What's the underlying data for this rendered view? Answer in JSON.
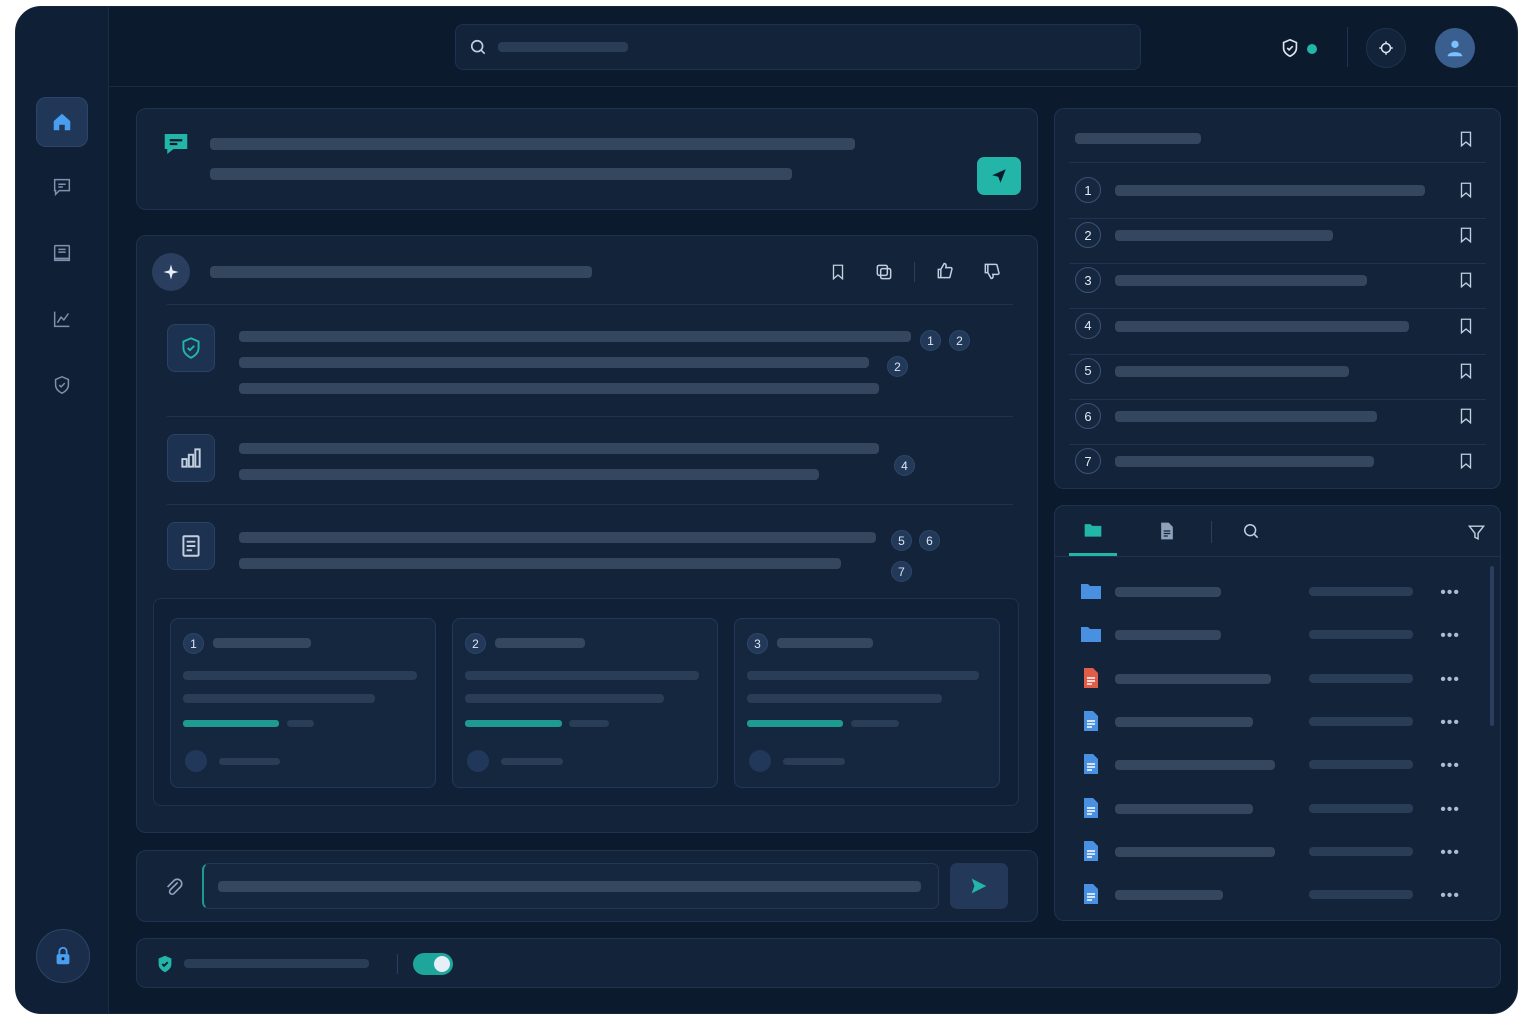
{
  "colors": {
    "background": "#0b1a2d",
    "accent": "#22b5a8",
    "panel": "#12233a",
    "file_blue": "#4a90e2",
    "file_red": "#e25c4a"
  },
  "icons": {
    "sidebar": [
      "home-icon",
      "chat-icon",
      "book-icon",
      "chart-icon",
      "shield-icon"
    ],
    "topbar": [
      "search-icon",
      "shield-check-icon",
      "settings-icon",
      "user-avatar-icon"
    ],
    "response_actions": [
      "bookmark-icon",
      "copy-icon",
      "thumbs-up-icon",
      "thumbs-down-icon"
    ],
    "file_tabs": [
      "folder-icon",
      "document-icon",
      "search-icon",
      "filter-icon"
    ]
  },
  "response": {
    "points": [
      {
        "icon": "shield-check-icon",
        "citations": [
          "1",
          "2",
          "2"
        ]
      },
      {
        "icon": "bar-chart-icon",
        "citations": [
          "4"
        ]
      },
      {
        "icon": "document-icon",
        "citations": [
          "5",
          "6",
          "7"
        ]
      }
    ],
    "source_cards": [
      {
        "number": "1",
        "progress": 0.6
      },
      {
        "number": "2",
        "progress": 0.6
      },
      {
        "number": "3",
        "progress": 0.6
      }
    ]
  },
  "saved_list": {
    "items": [
      "1",
      "2",
      "3",
      "4",
      "5",
      "6",
      "7"
    ]
  },
  "files": {
    "items": [
      {
        "type": "folder",
        "color": "#4a90e2"
      },
      {
        "type": "folder",
        "color": "#4a90e2"
      },
      {
        "type": "document",
        "color": "#e25c4a"
      },
      {
        "type": "document",
        "color": "#4a90e2"
      },
      {
        "type": "document",
        "color": "#4a90e2"
      },
      {
        "type": "document",
        "color": "#4a90e2"
      },
      {
        "type": "document",
        "color": "#4a90e2"
      },
      {
        "type": "document",
        "color": "#4a90e2"
      }
    ]
  },
  "status_bar": {
    "toggle_on": true
  }
}
